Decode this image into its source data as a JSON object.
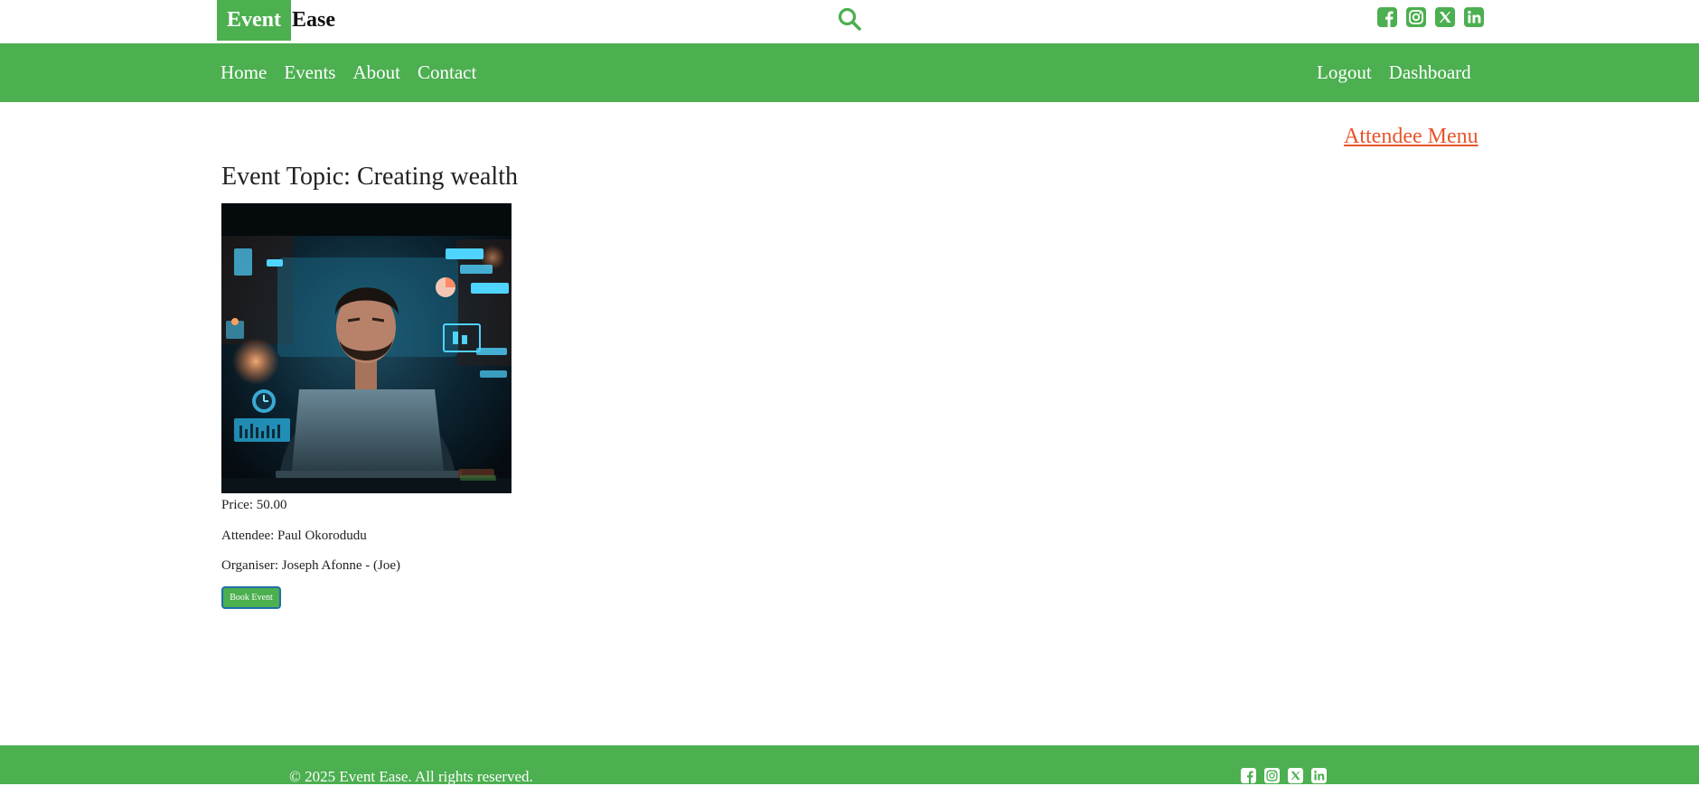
{
  "brand": {
    "part1": "Event",
    "part2": "Ease"
  },
  "header": {
    "search_icon": "search-icon",
    "social_icons": [
      "facebook-icon",
      "instagram-icon",
      "x-icon",
      "linkedin-icon"
    ]
  },
  "nav": {
    "left": [
      "Home",
      "Events",
      "About",
      "Contact"
    ],
    "right": [
      "Logout",
      "Dashboard"
    ]
  },
  "attendee_menu": "Attendee Menu",
  "event": {
    "title": "Event Topic: Creating wealth",
    "price": "Price: 50.00",
    "attendee": "Attendee: Paul Okorodudu",
    "organiser": "Organiser: Joseph Afonne - (Joe)",
    "book_label": "Book Event"
  },
  "footer": {
    "copyright": "© 2025 Event Ease. All rights reserved."
  },
  "colors": {
    "brand_green": "#4caf50",
    "accent_orange": "#e8542c",
    "white": "#ffffff"
  }
}
